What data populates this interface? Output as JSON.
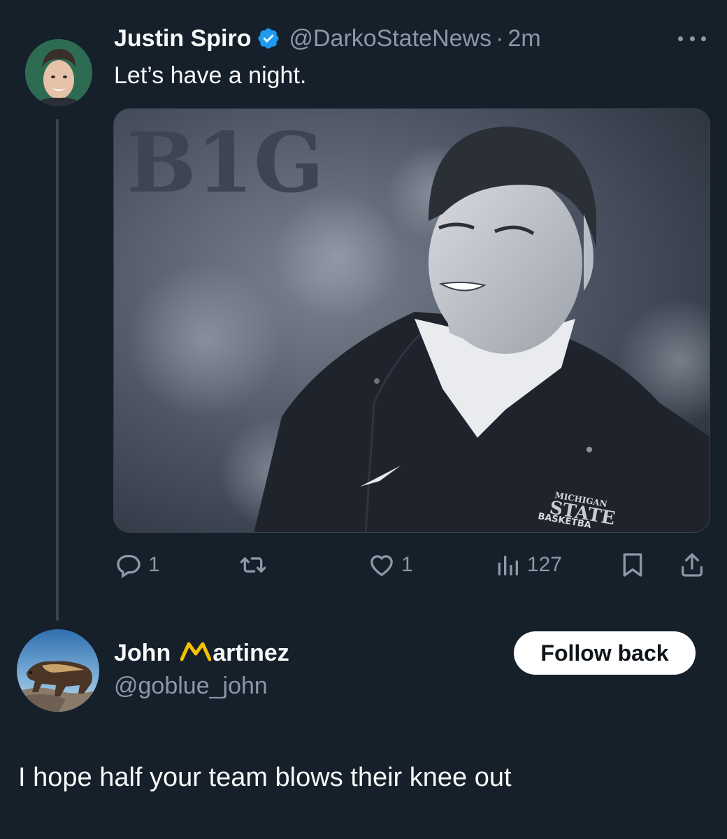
{
  "tweet": {
    "author_name": "Justin Spiro",
    "author_handle": "@DarkoStateNews",
    "separator": "·",
    "time": "2m",
    "text": "Let’s have a night.",
    "media": {
      "logo_text": "B1G",
      "jacket_text_1": "MICHIGAN",
      "jacket_text_2": "STATE",
      "jacket_text_3": "BASKETBA"
    },
    "stats": {
      "replies": "1",
      "likes": "1",
      "views": "127"
    }
  },
  "reply": {
    "first_name": "John",
    "last_name": "artinez",
    "handle": "@goblue_john",
    "follow_label": "Follow back",
    "text": "I hope half your team blows their knee out"
  },
  "colors": {
    "background": "#15202b",
    "text_primary": "#f7f9f9",
    "text_secondary": "#8b98a5",
    "verified_blue": "#1d9bf0",
    "maize": "#f2c300"
  },
  "icons": [
    "verified-badge-icon",
    "more-icon",
    "reply-icon",
    "retweet-icon",
    "like-icon",
    "views-icon",
    "bookmark-icon",
    "share-icon",
    "maize-m-emoji-icon"
  ]
}
